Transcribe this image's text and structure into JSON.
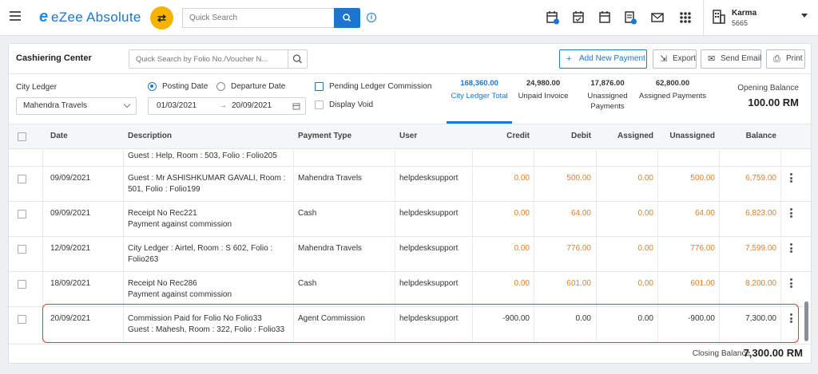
{
  "topbar": {
    "logo_e": "e",
    "app_name": "eZee Absolute",
    "search_placeholder": "Quick Search",
    "user_name": "Karma",
    "user_code": "5665",
    "icons": [
      "menu-icon",
      "shuffle-icon",
      "search-icon",
      "info-icon",
      "calendar-add-icon",
      "calendar-check-icon",
      "calendar-icon",
      "document-icon",
      "mail-icon",
      "apps-grid-icon",
      "hotel-icon"
    ]
  },
  "header": {
    "title": "Cashiering Center",
    "folio_search_placeholder": "Quick Search by Folio No./Voucher N...",
    "add_payment": "Add New Payment",
    "export": "Export",
    "send_email": "Send Email",
    "print": "Print"
  },
  "filters": {
    "ledger_label": "City Ledger",
    "ledger_value": "Mahendra Travels",
    "posting_date": "Posting Date",
    "departure_date": "Departure Date",
    "selected_date_type": "Posting Date",
    "date_from": "01/03/2021",
    "date_to": "20/09/2021",
    "pending_commission": "Pending Ledger Commission",
    "display_void": "Display Void"
  },
  "stats": [
    {
      "value": "168,360.00",
      "label": "City Ledger Total",
      "active": true
    },
    {
      "value": "24,980.00",
      "label": "Unpaid Invoice",
      "active": false
    },
    {
      "value": "17,876.00",
      "label": "Unassigned Payments",
      "active": false
    },
    {
      "value": "62,800.00",
      "label": "Assigned Payments",
      "active": false
    }
  ],
  "opening_balance": {
    "label": "Opening Balance",
    "value": "100.00 RM"
  },
  "table": {
    "columns": [
      "Date",
      "Description",
      "Payment Type",
      "User",
      "Credit",
      "Debit",
      "Assigned",
      "Unassigned",
      "Balance"
    ],
    "partial_row_desc": "Guest : Help, Room : 503, Folio : Folio205",
    "rows": [
      {
        "date": "09/09/2021",
        "desc1": "Guest : Mr ASHISHKUMAR GAVALI, Room :",
        "desc2": "501, Folio : Folio199",
        "type": "Mahendra Travels",
        "user": "helpdesksupport",
        "credit": "0.00",
        "debit": "500.00",
        "assigned": "0.00",
        "unassigned": "500.00",
        "balance": "6,759.00"
      },
      {
        "date": "09/09/2021",
        "desc1": "Receipt No Rec221",
        "desc2": "Payment against commission",
        "type": "Cash",
        "user": "helpdesksupport",
        "credit": "0.00",
        "debit": "64.00",
        "assigned": "0.00",
        "unassigned": "64.00",
        "balance": "6,823.00"
      },
      {
        "date": "12/09/2021",
        "desc1": "City Ledger : Airtel, Room : S 602, Folio :",
        "desc2": "Folio263",
        "type": "Mahendra Travels",
        "user": "helpdesksupport",
        "credit": "0.00",
        "debit": "776.00",
        "assigned": "0.00",
        "unassigned": "776.00",
        "balance": "7,599.00"
      },
      {
        "date": "18/09/2021",
        "desc1": "Receipt No Rec286",
        "desc2": "Payment against commission",
        "type": "Cash",
        "user": "helpdesksupport",
        "credit": "0.00",
        "debit": "601.00",
        "assigned": "0.00",
        "unassigned": "601.00",
        "balance": "8,200.00"
      },
      {
        "date": "20/09/2021",
        "desc1": "Commission Paid for Folio No Folio33",
        "desc2": "Guest : Mahesh, Room : 322, Folio : Folio33",
        "type": "Agent Commission",
        "user": "helpdesksupport",
        "credit": "-900.00",
        "debit": "0.00",
        "assigned": "0.00",
        "unassigned": "-900.00",
        "balance": "7,300.00"
      }
    ]
  },
  "closing_balance": {
    "label": "Closing Balance",
    "value": "7,300.00 RM"
  },
  "colors": {
    "accent": "#1976d2",
    "orange": "#e67e22",
    "highlight": "#e53935",
    "shuffle": "#f6b400"
  }
}
